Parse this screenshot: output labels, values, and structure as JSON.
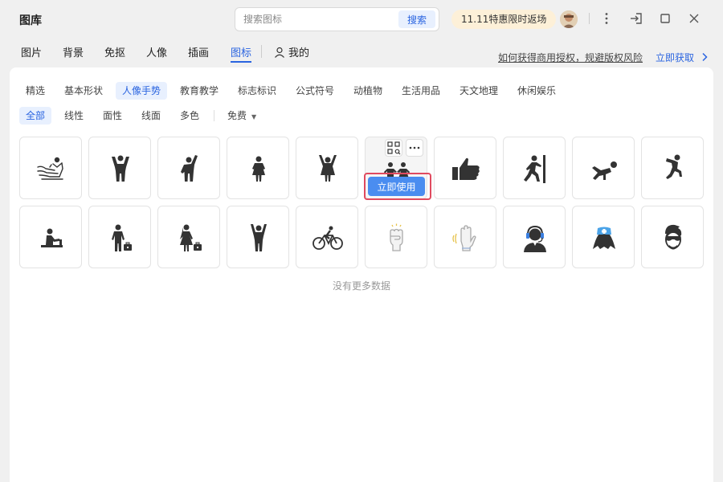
{
  "window": {
    "title": "图库"
  },
  "search": {
    "placeholder": "搜索图标",
    "button_label": "搜索"
  },
  "header": {
    "promo": "11.11特惠限时返场"
  },
  "main_tabs": [
    {
      "label": "图片"
    },
    {
      "label": "背景"
    },
    {
      "label": "免抠"
    },
    {
      "label": "人像"
    },
    {
      "label": "插画"
    },
    {
      "label": "图标",
      "active": true
    },
    {
      "label": "我的"
    }
  ],
  "links": {
    "license": "如何获得商用授权，规避版权风险",
    "get_now": "立即获取"
  },
  "categories": [
    {
      "label": "精选"
    },
    {
      "label": "基本形状"
    },
    {
      "label": "人像手势",
      "active": true
    },
    {
      "label": "教育教学"
    },
    {
      "label": "标志标识"
    },
    {
      "label": "公式符号"
    },
    {
      "label": "动植物"
    },
    {
      "label": "生活用品"
    },
    {
      "label": "天文地理"
    },
    {
      "label": "休闲娱乐"
    }
  ],
  "styles": [
    {
      "label": "全部",
      "active": true
    },
    {
      "label": "线性"
    },
    {
      "label": "面性"
    },
    {
      "label": "线面"
    },
    {
      "label": "多色"
    }
  ],
  "price_filter": {
    "selected": "免费"
  },
  "icons_row1": [
    {
      "name": "massage-icon"
    },
    {
      "name": "person-arms-up-icon"
    },
    {
      "name": "person-wave-icon"
    },
    {
      "name": "girl-icon"
    },
    {
      "name": "girl-arms-up-icon"
    },
    {
      "name": "two-children-icon"
    },
    {
      "name": "thumbs-up-icon"
    },
    {
      "name": "person-push-wall-icon"
    },
    {
      "name": "person-crawl-icon"
    },
    {
      "name": "person-jump-icon"
    }
  ],
  "icons_row2": [
    {
      "name": "person-desk-icon"
    },
    {
      "name": "man-briefcase-icon"
    },
    {
      "name": "woman-briefcase-icon"
    },
    {
      "name": "man-cheer-icon"
    },
    {
      "name": "cyclist-icon"
    },
    {
      "name": "raised-fist-icon"
    },
    {
      "name": "raised-hand-icon"
    },
    {
      "name": "headset-agent-icon"
    },
    {
      "name": "nurse-icon"
    },
    {
      "name": "sunglasses-man-icon"
    }
  ],
  "hover_card": {
    "use_label": "立即使用"
  },
  "footer": {
    "no_more": "没有更多数据"
  },
  "colors": {
    "accent": "#2a64e0",
    "use_button": "#4a8df0",
    "highlight": "#e04a5f",
    "icon_dark": "#333333",
    "promo_bg": "#fdf0d8"
  }
}
